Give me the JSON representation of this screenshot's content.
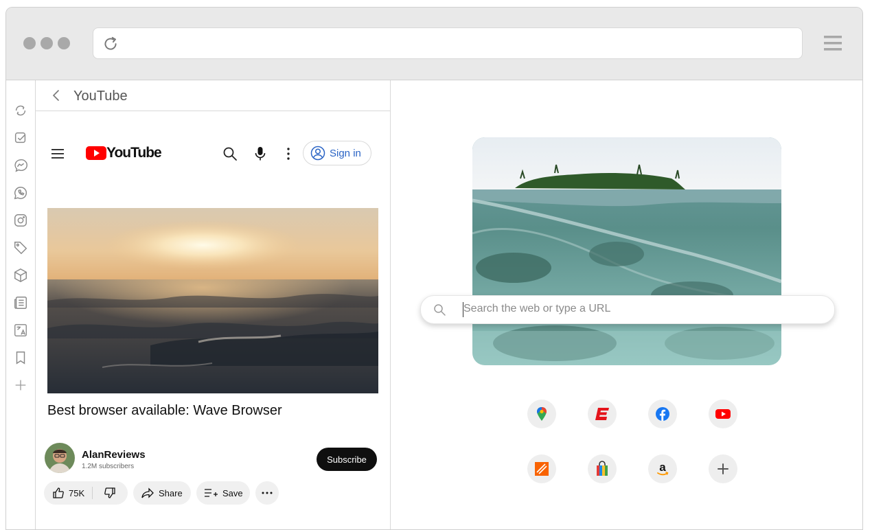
{
  "panel": {
    "title": "YouTube"
  },
  "youtube": {
    "logo_text": "YouTube",
    "sign_in_label": "Sign in",
    "video_title": "Best browser available: Wave Browser",
    "channel_name": "AlanReviews",
    "subscribers": "1.2M subscribers",
    "subscribe_label": "Subscribe",
    "like_count": "75K",
    "share_label": "Share",
    "save_label": "Save"
  },
  "newtab": {
    "search_placeholder": "Search the web or type a URL"
  },
  "rail_icons": [
    "sync-icon",
    "checklist-icon",
    "messenger-icon",
    "whatsapp-icon",
    "instagram-icon",
    "tag-icon",
    "box-icon",
    "news-icon",
    "translate-icon",
    "bookmark-icon",
    "add-icon"
  ],
  "shortcuts": [
    "google-maps-icon",
    "espn-icon",
    "facebook-icon",
    "youtube-icon",
    "home-depot-icon",
    "shopping-bag-icon",
    "amazon-icon",
    "add-shortcut-icon"
  ],
  "colors": {
    "youtube_red": "#ff0000",
    "signin_blue": "#2a64c5",
    "subscribe_black": "#0f0f0f",
    "facebook_blue": "#1877f2"
  }
}
